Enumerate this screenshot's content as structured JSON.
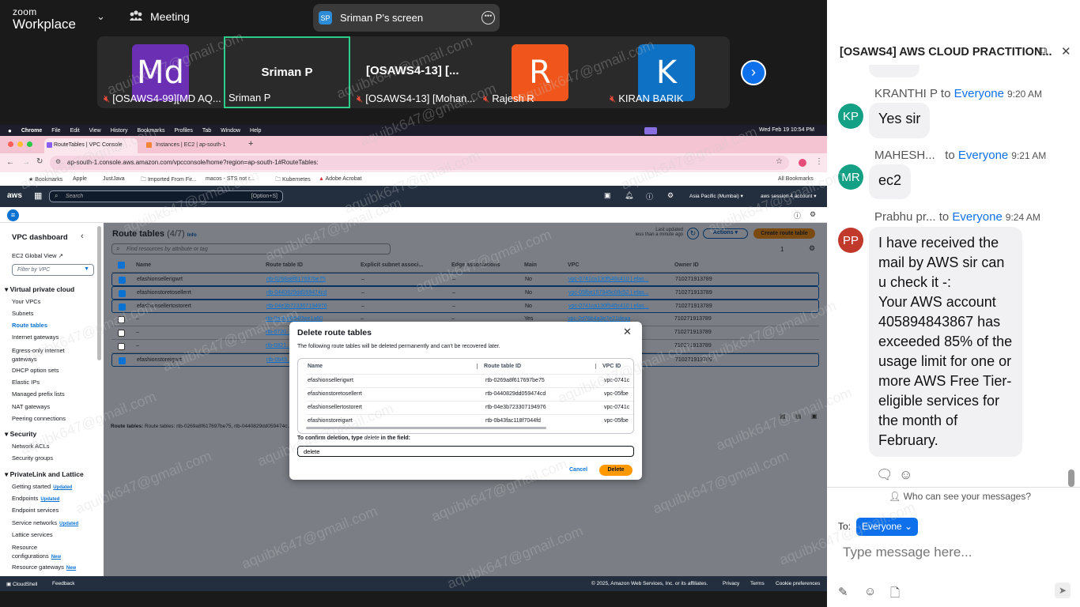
{
  "zoom": {
    "logo_line1": "zoom",
    "logo_line2": "Workplace",
    "meeting_label": "Meeting",
    "share_badge": "SP",
    "share_title": "Sriman P's screen",
    "window_controls": [
      "minimize-icon",
      "restore-icon",
      "close-icon"
    ],
    "participants": [
      {
        "initials": "Md",
        "color": "#6a2fb3",
        "name": "[OSAWS4-99][MD AQ..."
      },
      {
        "big_name": "Sriman P",
        "name": "Sriman P",
        "active": true
      },
      {
        "big_name": "[OSAWS4-13] [...",
        "name": "[OSAWS4-13] [Mohan..."
      },
      {
        "initials": "R",
        "color": "#f0561c",
        "name": "Rajesh R"
      },
      {
        "initials": "K",
        "color": "#0e71c3",
        "name": "KIRAN BARIK"
      }
    ]
  },
  "mac": {
    "menu": [
      "Chrome",
      "File",
      "Edit",
      "View",
      "History",
      "Bookmarks",
      "Profiles",
      "Tab",
      "Window",
      "Help"
    ],
    "clock": "Wed Feb 19  10:54 PM"
  },
  "browser": {
    "tab1": "RouteTables | VPC Console",
    "tab2": "Instances | EC2 | ap-south-1",
    "url": "ap-south-1.console.aws.amazon.com/vpcconsole/home?region=ap-south-1#RouteTables:",
    "bookmarks": [
      "Bookmarks",
      "Apple",
      "JustJava",
      "Imported From Fir...",
      "macos - STS not r...",
      "Kubernetes",
      "Adobe Acrobat"
    ],
    "all_bookmarks": "All Bookmarks"
  },
  "aws": {
    "logo": "aws",
    "search_placeholder": "Search",
    "search_shortcut": "[Option+S]",
    "region": "Asia Pacific (Mumbai) ▾",
    "account": "aws session 4 account ▾",
    "footer_cloudshell": "CloudShell",
    "footer_feedback": "Feedback",
    "footer_copyright": "© 2025, Amazon Web Services, Inc. or its affiliates.",
    "footer_links": [
      "Privacy",
      "Terms",
      "Cookie preferences"
    ]
  },
  "sidebar": {
    "title": "VPC dashboard",
    "ec2_link": "EC2 Global View",
    "filter_placeholder": "Filter by VPC",
    "sections": [
      {
        "title": "Virtual private cloud",
        "items": [
          "Your VPCs",
          "Subnets",
          "Route tables",
          "Internet gateways",
          "Egress-only internet gateways",
          "DHCP option sets",
          "Elastic IPs",
          "Managed prefix lists",
          "NAT gateways",
          "Peering connections"
        ]
      },
      {
        "title": "Security",
        "items": [
          "Network ACLs",
          "Security groups"
        ]
      },
      {
        "title": "PrivateLink and Lattice",
        "items": [
          "Getting started",
          "Endpoints",
          "Endpoint services",
          "Service networks",
          "Lattice services",
          "Resource configurations",
          "Resource gateways"
        ]
      }
    ],
    "badge_updated": "Updated",
    "badge_new": "New"
  },
  "main": {
    "title": "Route tables",
    "count": "(4/7)",
    "info": "Info",
    "last_updated_label": "Last updated",
    "last_updated_value": "less than a minute ago",
    "actions_label": "Actions ▾",
    "create_label": "Create route table",
    "search_placeholder": "Find resources by attribute or tag",
    "page": "1",
    "columns": [
      "Name",
      "Route table ID",
      "Explicit subnet associ...",
      "Edge associations",
      "Main",
      "VPC",
      "Owner ID"
    ],
    "rows": [
      {
        "checked": true,
        "name": "efashionsellerigwrt",
        "id": "rtb-0268a8f617697be75",
        "subnet": "–",
        "edge": "–",
        "main": "No",
        "vpc": "vpc-0741ca130f540c410 | efas...",
        "owner": "710271913789"
      },
      {
        "checked": true,
        "name": "efashionstoretosellerrt",
        "id": "rtb-0440829dd059474cd",
        "subnet": "–",
        "edge": "–",
        "main": "No",
        "vpc": "vpc-05fbe157945c08c52 | efas...",
        "owner": "710271913789"
      },
      {
        "checked": true,
        "name": "efashionsellertostorert",
        "id": "rtb-04e3b723307194976",
        "subnet": "–",
        "edge": "–",
        "main": "No",
        "vpc": "vpc-0741ca130f540c410 | efas...",
        "owner": "710271913789"
      },
      {
        "checked": false,
        "name": "–",
        "id": "rtb-0acfce064f3ee1a60",
        "subnet": "–",
        "edge": "–",
        "main": "Yes",
        "vpc": "vpc-2d76b4a3e7e21deaa",
        "owner": "710271913789"
      },
      {
        "checked": false,
        "name": "–",
        "id": "rtb-0720...",
        "subnet": "–",
        "edge": "–",
        "main": "",
        "vpc": "vpc-...fas...",
        "owner": "710271913789"
      },
      {
        "checked": false,
        "name": "–",
        "id": "rtb-0821...",
        "subnet": "–",
        "edge": "–",
        "main": "",
        "vpc": "vpc-...fas...",
        "owner": "710271913789"
      },
      {
        "checked": true,
        "name": "efashionstoreigwrt",
        "id": "rtb-0b43...",
        "subnet": "–",
        "edge": "–",
        "main": "",
        "vpc": "vpc-...efas...",
        "owner": "710271913789"
      }
    ],
    "selection_footer": "Route tables: rtb-0269a8f617697be75, rtb-0440829dd059474c..."
  },
  "modal": {
    "title": "Delete route tables",
    "description": "The following route tables will be deleted permanently and can't be recovered later.",
    "columns": [
      "Name",
      "Route table ID",
      "VPC ID"
    ],
    "rows": [
      {
        "name": "efashionsellerigwrt",
        "id": "rtb-0269a8f617697be75",
        "vpc": "vpc-0741c"
      },
      {
        "name": "efashionstoretosellerrt",
        "id": "rtb-0440829dd059474cd",
        "vpc": "vpc-05fbe"
      },
      {
        "name": "efashionsellertostorert",
        "id": "rtb-04e3b723307194976",
        "vpc": "vpc-0741c"
      },
      {
        "name": "efashionstoreigwrt",
        "id": "rtb-0b43fac118f7044fd",
        "vpc": "vpc-05fbe"
      }
    ],
    "confirm_prefix": "To confirm deletion, type ",
    "confirm_word": "delete",
    "confirm_suffix": " in the field:",
    "input_value": "delete",
    "cancel_label": "Cancel",
    "delete_label": "Delete"
  },
  "chat": {
    "title": "[OSAWS4] AWS CLOUD PRACTITION...",
    "messages": [
      {
        "sender": "KRANTHI P",
        "to": "to",
        "audience": "Everyone",
        "time": "9:20 AM",
        "initials": "KP",
        "color": "#14a085",
        "text": "Yes sir"
      },
      {
        "sender": "MAHESH...",
        "to": "to",
        "audience": "Everyone",
        "time": "9:21 AM",
        "initials": "MR",
        "color": "#14a085",
        "text": "ec2"
      },
      {
        "sender": "Prabhu pr...",
        "to": "to",
        "audience": "Everyone",
        "time": "9:24 AM",
        "initials": "PP",
        "color": "#c0392b",
        "text": "I have received the mail by AWS sir can u check it -:\nYour AWS account 405894843867 has exceeded 85% of the usage limit for one or more AWS Free Tier-eligible services for the month of February."
      }
    ],
    "who_can_see": "Who can see your messages?",
    "to_label": "To:",
    "to_value": "Everyone",
    "input_placeholder": "Type message here..."
  },
  "watermark": "aquibk647@gmail.com"
}
